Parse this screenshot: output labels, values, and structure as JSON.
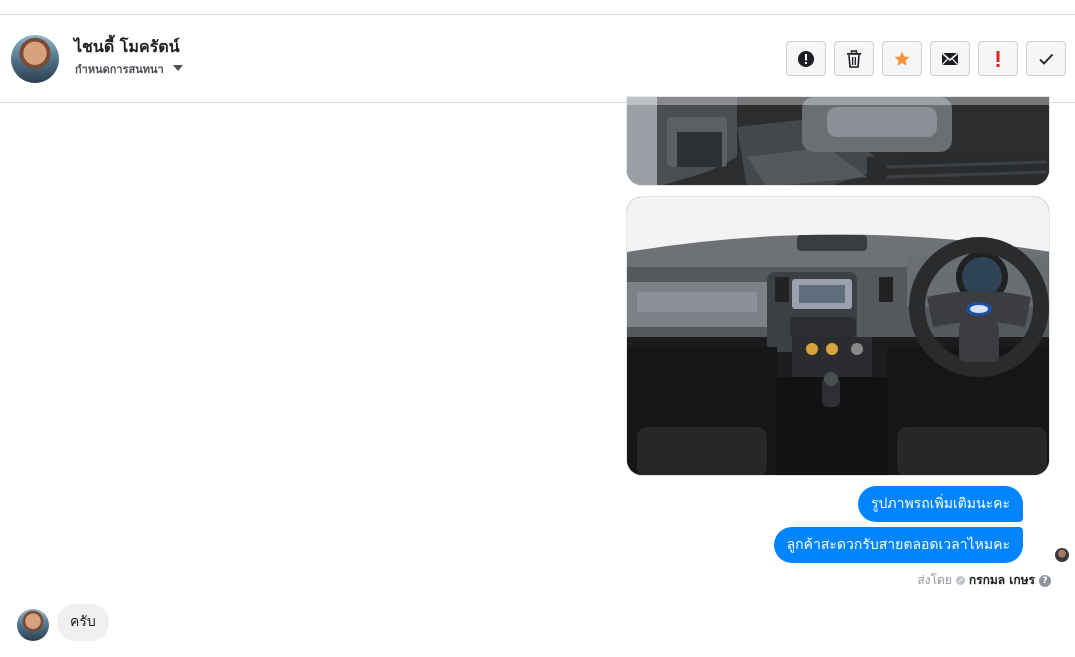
{
  "header": {
    "contact_name": "ไชนดี้ โมครัตน์",
    "conversation_label": "กำหนดการสนทนา",
    "actions": [
      {
        "name": "mark-spam-button",
        "icon": "alert-circle-icon"
      },
      {
        "name": "delete-button",
        "icon": "trash-icon"
      },
      {
        "name": "star-button",
        "icon": "star-icon",
        "color": "#f7923b"
      },
      {
        "name": "mark-unread-button",
        "icon": "envelope-icon"
      },
      {
        "name": "mark-important-button",
        "icon": "exclamation-icon",
        "color": "#e02020"
      },
      {
        "name": "mark-done-button",
        "icon": "checkmark-icon"
      }
    ]
  },
  "messages": {
    "outgoing": [
      {
        "text": "รูปภาพรถเพิ่มเติมนะคะ"
      },
      {
        "text": "ลูกค้าสะดวกรับสายตลอดเวลาไหมคะ"
      }
    ],
    "sent_by_label": "ส่งโดย",
    "sender_name": "กรกมล เกษร",
    "incoming": [
      {
        "text": "ครับ"
      }
    ]
  },
  "colors": {
    "outgoing_bubble": "#0084ff",
    "incoming_bubble": "#f1f0f0",
    "star": "#f7923b",
    "important": "#e02020"
  }
}
